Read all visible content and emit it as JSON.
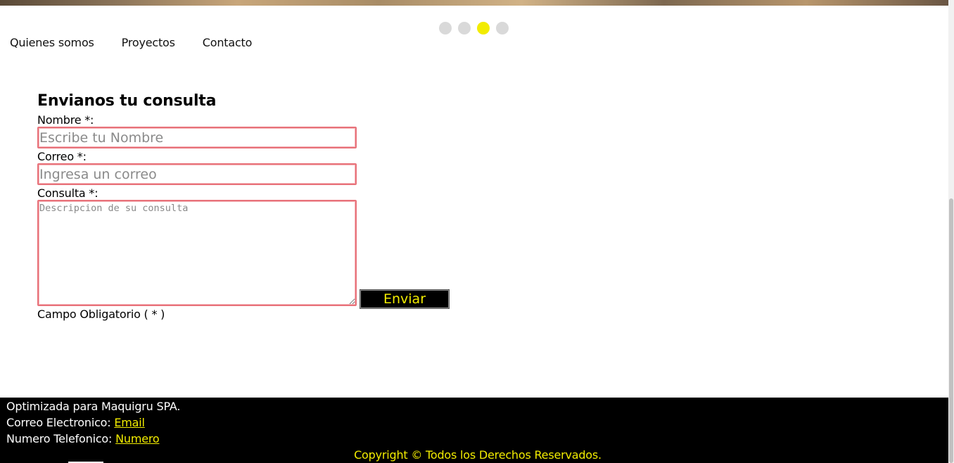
{
  "slider": {
    "dots": [
      {
        "name": "slide-1",
        "active": false
      },
      {
        "name": "slide-2",
        "active": false
      },
      {
        "name": "slide-3",
        "active": true
      },
      {
        "name": "slide-4",
        "active": false
      }
    ],
    "active_color": "#f2ec00"
  },
  "nav": {
    "items": [
      {
        "label": "Quienes somos"
      },
      {
        "label": "Proyectos"
      },
      {
        "label": "Contacto"
      }
    ]
  },
  "form": {
    "title": "Envianos tu consulta",
    "name_label": "Nombre *:",
    "name_placeholder": "Escribe tu Nombre",
    "email_label": "Correo *:",
    "email_placeholder": "Ingresa un correo",
    "query_label": "Consulta *:",
    "query_placeholder": "Descripcion de su consulta",
    "submit_label": "Enviar",
    "required_note": "Campo Obligatorio ( * )"
  },
  "footer": {
    "company": "Optimizada para Maquigru SPA.",
    "email_prefix": "Correo Electronico: ",
    "email_link": "Email",
    "phone_prefix": "Numero Telefonico: ",
    "phone_link": "Numero",
    "copyright": "Copyright © Todos los Derechos Reservados."
  },
  "colors": {
    "accent": "#f2ec00",
    "input_border": "#e8727a",
    "footer_bg": "#000000"
  }
}
